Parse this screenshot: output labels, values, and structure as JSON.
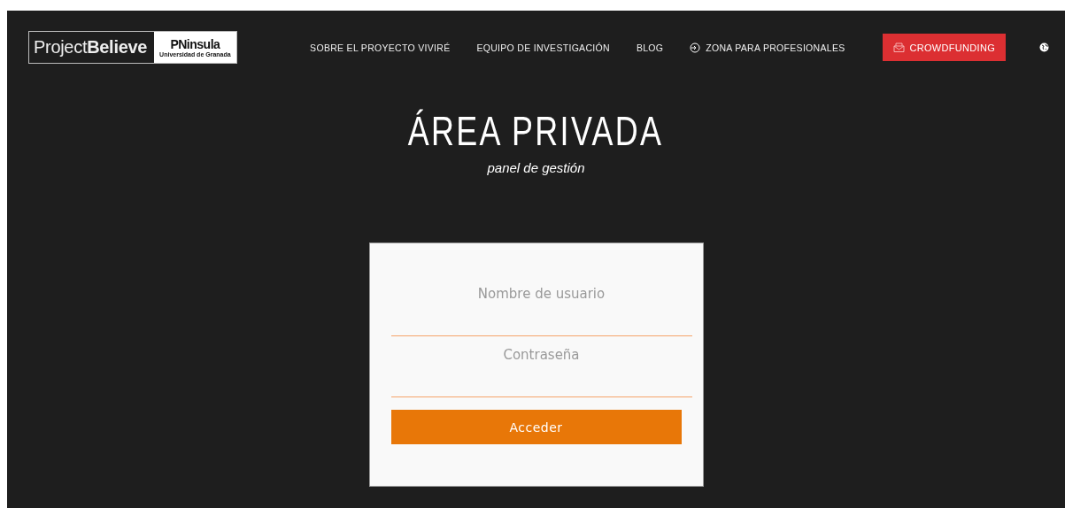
{
  "logo": {
    "primary": "Project",
    "primary_bold": "Believe",
    "partner": "PNinsula",
    "partner_subtitle": "Universidad de Granada"
  },
  "nav": [
    {
      "kind": "link",
      "label": "SOBRE EL PROYECTO VIVIRÉ"
    },
    {
      "kind": "link",
      "label": "EQUIPO DE INVESTIGACIÓN"
    },
    {
      "kind": "link",
      "label": "BLOG"
    },
    {
      "kind": "login",
      "label": "ZONA PARA PROFESIONALES"
    },
    {
      "kind": "button",
      "label": "CROWDFUNDING"
    },
    {
      "kind": "language"
    }
  ],
  "heading": {
    "title": "ÁREA PRIVADA",
    "subtitle": "panel de gestión"
  },
  "login_form": {
    "fields": [
      {
        "placeholder": "Nombre de usuario"
      },
      {
        "placeholder": "Contraseña"
      }
    ],
    "submit": "Acceder"
  }
}
